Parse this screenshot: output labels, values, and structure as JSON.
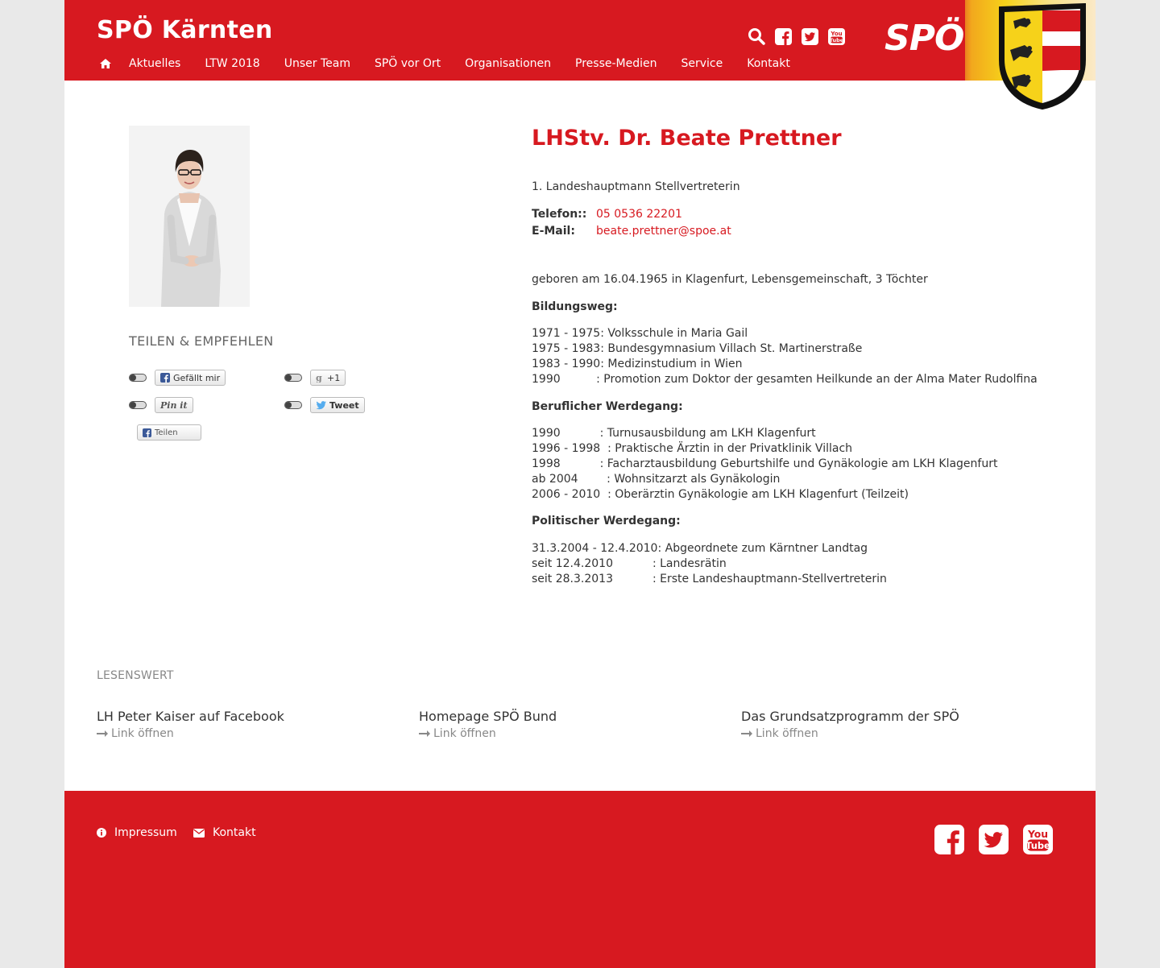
{
  "header": {
    "site_title": "SPÖ Kärnten",
    "logo_text": "SPÖ",
    "nav": [
      "Aktuelles",
      "LTW 2018",
      "Unser Team",
      "SPÖ vor Ort",
      "Organisationen",
      "Presse-Medien",
      "Service",
      "Kontakt"
    ]
  },
  "sidebar": {
    "share_title": "TEILEN & EMPFEHLEN",
    "buttons": {
      "facebook_like": "Gefällt mir",
      "google_plus": "+1",
      "pinterest": "Pin it",
      "tweet": "Tweet",
      "facebook_share": "Teilen"
    }
  },
  "person": {
    "name": "LHStv. Dr. Beate Prettner",
    "role": "1. Landeshauptmann Stellvertreterin",
    "phone_label": "Telefon::",
    "phone": "05 0536 22201",
    "email_label": "E-Mail:",
    "email": "beate.prettner@spoe.at",
    "born": "geboren am 16.04.1965 in Klagenfurt, Lebensgemeinschaft, 3 Töchter",
    "education_title": "Bildungsweg:",
    "education": [
      "1971 - 1975: Volksschule in Maria Gail",
      "1975 - 1983: Bundesgymnasium Villach St. Martinerstraße",
      "1983 - 1990: Medizinstudium in Wien",
      "1990          : Promotion zum Doktor der gesamten Heilkunde an der Alma Mater Rudolfina"
    ],
    "career_title": "Beruflicher Werdegang:",
    "career": [
      "1990           : Turnusausbildung am LKH Klagenfurt",
      "1996 - 1998  : Praktische Ärztin in der Privatklinik Villach",
      "1998           : Facharztausbildung Geburtshilfe und Gynäkologie am LKH Klagenfurt",
      "ab 2004        : Wohnsitzarzt als Gynäkologin",
      "2006 - 2010  : Oberärztin Gynäkologie am LKH Klagenfurt (Teilzeit)"
    ],
    "political_title": "Politischer Werdegang:",
    "political": [
      "31.3.2004 - 12.4.2010: Abgeordnete zum Kärntner Landtag",
      "seit 12.4.2010           : Landesrätin",
      "seit 28.3.2013           : Erste Landeshauptmann-Stellvertreterin"
    ]
  },
  "lesenswert": {
    "title": "LESENSWERT",
    "items": [
      {
        "title": "LH Peter Kaiser auf Facebook",
        "link": "Link öffnen"
      },
      {
        "title": "Homepage SPÖ Bund",
        "link": "Link öffnen"
      },
      {
        "title": "Das Grundsatzprogramm der SPÖ",
        "link": "Link öffnen"
      }
    ]
  },
  "footer": {
    "impressum": "Impressum",
    "kontakt": "Kontakt"
  },
  "colors": {
    "brand_red": "#d71920",
    "accent_yellow": "#f6d21a"
  }
}
